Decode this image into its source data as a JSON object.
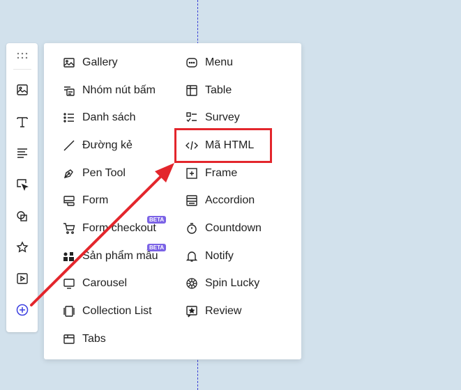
{
  "menu": {
    "left_column": [
      {
        "label": "Gallery",
        "icon": "gallery-icon"
      },
      {
        "label": "Nhóm nút bấm",
        "icon": "button-group-icon"
      },
      {
        "label": "Danh sách",
        "icon": "list-icon"
      },
      {
        "label": "Đường kẻ",
        "icon": "line-icon"
      },
      {
        "label": "Pen Tool",
        "icon": "pen-tool-icon"
      },
      {
        "label": "Form",
        "icon": "form-icon"
      },
      {
        "label": "Form checkout",
        "icon": "cart-icon",
        "badge": "BETA"
      },
      {
        "label": "Sản phẩm mẫu",
        "icon": "product-icon",
        "badge": "BETA"
      },
      {
        "label": "Carousel",
        "icon": "carousel-icon"
      },
      {
        "label": "Collection List",
        "icon": "collection-list-icon"
      },
      {
        "label": "Tabs",
        "icon": "tabs-icon"
      }
    ],
    "right_column": [
      {
        "label": "Menu",
        "icon": "menu-icon"
      },
      {
        "label": "Table",
        "icon": "table-icon"
      },
      {
        "label": "Survey",
        "icon": "survey-icon"
      },
      {
        "label": "Mã HTML",
        "icon": "code-icon"
      },
      {
        "label": "Frame",
        "icon": "frame-icon"
      },
      {
        "label": "Accordion",
        "icon": "accordion-icon"
      },
      {
        "label": "Countdown",
        "icon": "countdown-icon"
      },
      {
        "label": "Notify",
        "icon": "bell-icon"
      },
      {
        "label": "Spin Lucky",
        "icon": "spin-wheel-icon"
      },
      {
        "label": "Review",
        "icon": "review-icon"
      }
    ]
  },
  "toolbar": {
    "items": [
      "drag-handle-icon",
      "image-icon",
      "text-icon",
      "paragraph-icon",
      "cursor-icon",
      "shapes-icon",
      "star-icon",
      "video-icon",
      "add-icon"
    ]
  },
  "colors": {
    "accent": "#3b3fe0",
    "annotation": "#e3262c",
    "beta": "#7b63e6",
    "background": "#d2e1ec"
  }
}
